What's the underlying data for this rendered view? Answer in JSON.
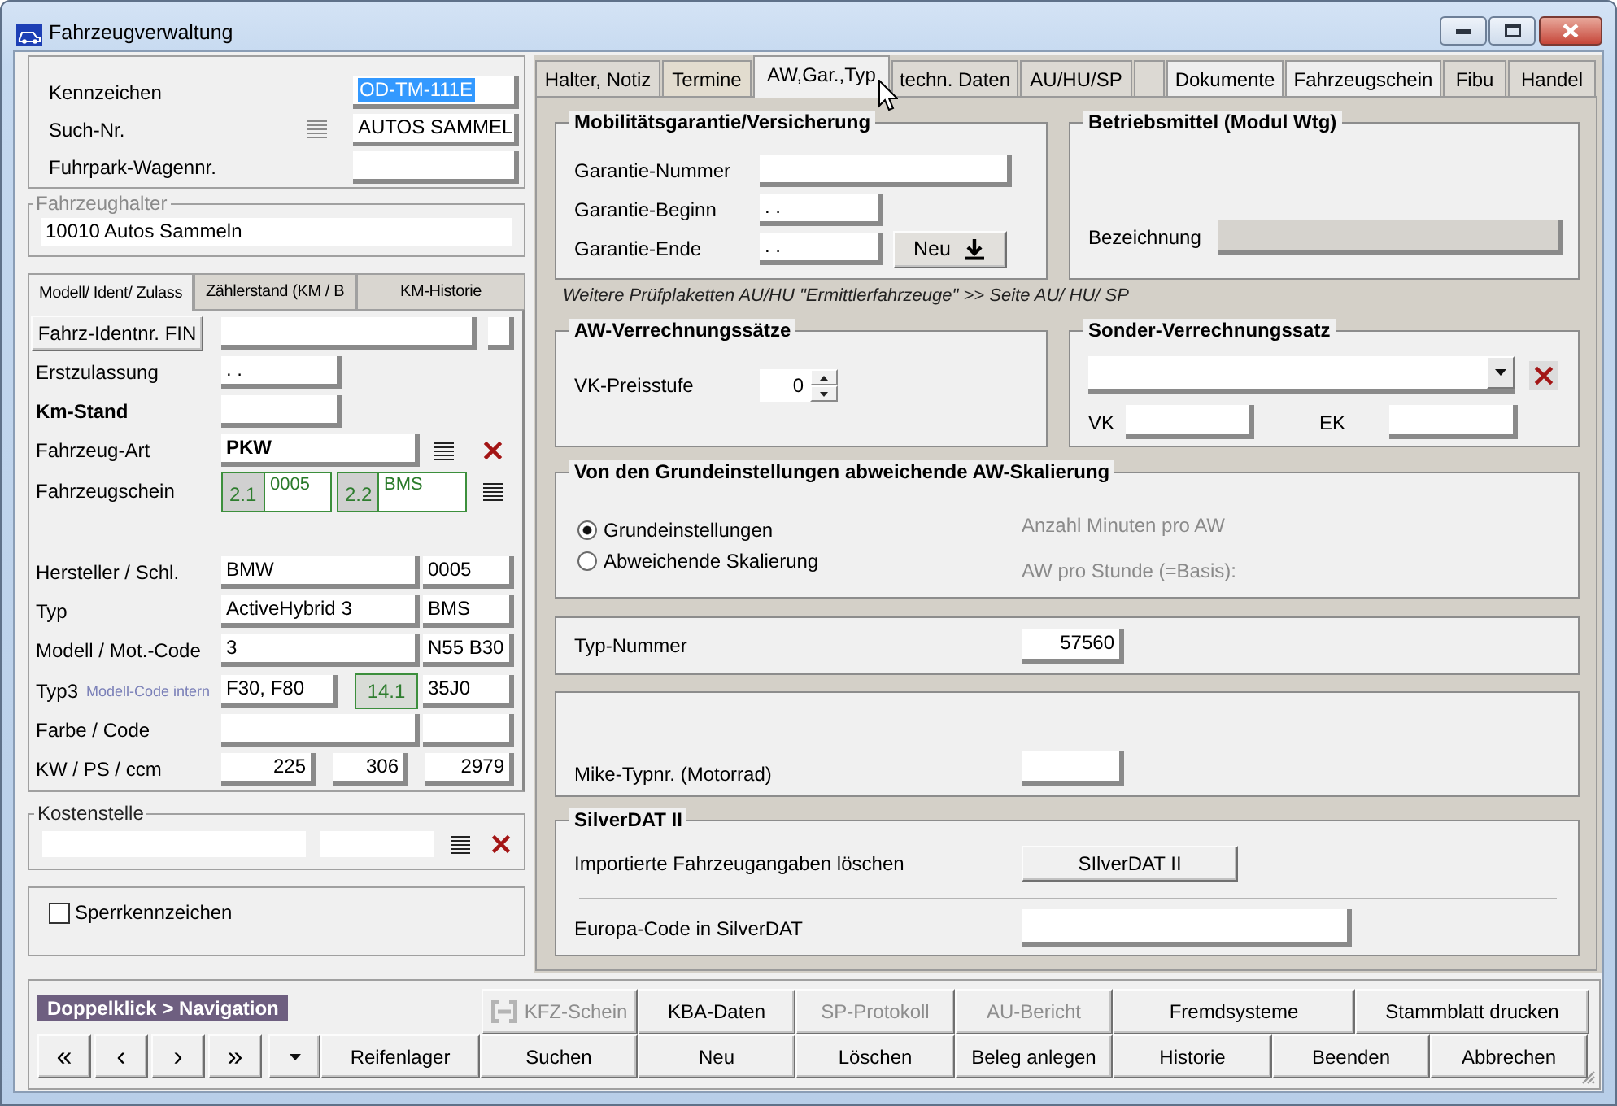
{
  "window": {
    "title": "Fahrzeugverwaltung"
  },
  "identity": {
    "rows": [
      {
        "label": "Kennzeichen",
        "value": "OD-TM-111E",
        "highlighted": true,
        "list_icon": false
      },
      {
        "label": "Such-Nr.",
        "value": "AUTOS SAMMEL",
        "highlighted": false,
        "list_icon": true
      },
      {
        "label": "Fuhrpark-Wagennr.",
        "highlighted": false,
        "list_icon": false
      }
    ]
  },
  "owner": {
    "legend": "Fahrzeughalter",
    "value": "10010 Autos Sammeln"
  },
  "left_tabs": [
    {
      "label": "Modell/ Ident/ Zulass",
      "selected": true
    },
    {
      "label": "Zählerstand (KM / B",
      "selected": false
    },
    {
      "label": "KM-Historie",
      "selected": false
    }
  ],
  "vehicle": {
    "rows": [
      {
        "kind": "fin",
        "button": "Fahrz-Identnr. FIN"
      },
      {
        "kind": "single",
        "label": "Erstzulassung",
        "value": ". .",
        "bold": false
      },
      {
        "kind": "single",
        "label": "Km-Stand",
        "bold": true
      },
      {
        "kind": "lookup",
        "label": "Fahrzeug-Art",
        "value": "PKW"
      },
      {
        "kind": "registration",
        "label": "Fahrzeugschein",
        "codes": [
          {
            "code": "2.1",
            "value": "0005"
          },
          {
            "code": "2.2",
            "value": "BMS"
          }
        ]
      },
      {
        "kind": "pair",
        "label": "Hersteller / Schl.",
        "value": "BMW",
        "key": "0005"
      },
      {
        "kind": "pair",
        "label": "Typ",
        "value": "ActiveHybrid 3",
        "key": "BMS"
      },
      {
        "kind": "pair",
        "label": "Modell / Mot.-Code",
        "value": "3",
        "key": "N55 B30"
      },
      {
        "kind": "typ3",
        "label": "Typ3",
        "hint": "Modell-Code intern",
        "value": "F30, F80",
        "badge": "14.1",
        "key": "35J0"
      },
      {
        "kind": "pair",
        "label": "Farbe / Code"
      },
      {
        "kind": "triple",
        "label": "KW / PS / ccm",
        "values": [
          "225",
          "306",
          "2979"
        ]
      }
    ]
  },
  "cost_center": {
    "legend": "Kostenstelle"
  },
  "lock": {
    "label": "Sperrkennzeichen",
    "checked": false
  },
  "tabs": [
    {
      "label": "Halter, Notiz",
      "selected": false
    },
    {
      "label": "Termine",
      "selected": false
    },
    {
      "label": "AW,Gar.,Typ",
      "selected": true
    },
    {
      "label": "techn. Daten",
      "selected": false
    },
    {
      "label": "AU/HU/SP",
      "selected": false
    },
    {
      "selected": false
    },
    {
      "label": "Dokumente",
      "selected": false
    },
    {
      "label": "Fahrzeugschein",
      "selected": false
    },
    {
      "label": "Fibu",
      "selected": false
    },
    {
      "label": "Handel",
      "selected": false
    }
  ],
  "guarantee": {
    "legend": "Mobilitätsgarantie/Versicherung",
    "rows": [
      {
        "kind": "text",
        "label": "Garantie-Nummer"
      },
      {
        "kind": "date",
        "label": "Garantie-Beginn",
        "value": ". ."
      },
      {
        "kind": "date",
        "label": "Garantie-Ende",
        "value": ". ."
      }
    ],
    "button": "Neu"
  },
  "resources": {
    "legend": "Betriebsmittel (Modul Wtg)",
    "label": "Bezeichnung",
    "disabled": true
  },
  "note": "Weitere Prüfplaketten AU/HU \"Ermittlerfahrzeuge\" >> Seite AU/ HU/ SP",
  "rates": {
    "legend": "AW-Verrechnungssätze",
    "label": "VK-Preisstufe",
    "value": "0"
  },
  "special_rate": {
    "legend": "Sonder-Verrechnungssatz",
    "vk_label": "VK",
    "ek_label": "EK"
  },
  "scaling": {
    "legend": "Von den Grundeinstellungen abweichende AW-Skalierung",
    "options": [
      {
        "label": "Grundeinstellungen",
        "selected": true
      },
      {
        "label": "Abweichende Skalierung",
        "selected": false
      }
    ],
    "info": [
      {
        "label": "Anzahl Minuten pro AW",
        "disabled": true
      },
      {
        "label": "AW pro Stunde (=Basis):",
        "disabled": true
      }
    ]
  },
  "type_number": {
    "label": "Typ-Nummer",
    "value": "57560"
  },
  "motorcycle": {
    "label": "Mike-Typnr. (Motorrad)"
  },
  "silverdat": {
    "legend": "SilverDAT II",
    "import_label": "Importierte Fahrzeugangaben löschen",
    "button": "SIlverDAT II",
    "code_label": "Europa-Code in SilverDAT"
  },
  "bottom_bar": {
    "hint": "Doppelklick > Navigation",
    "nav_buttons": [
      "«",
      "‹",
      "›",
      "»"
    ],
    "top_buttons": [
      {
        "label": "KFZ-Schein",
        "kind": "icon",
        "disabled": true
      },
      {
        "label": "KBA-Daten",
        "kind": "text",
        "disabled": false
      },
      {
        "label": "SP-Protokoll",
        "kind": "text",
        "disabled": true
      },
      {
        "label": "AU-Bericht",
        "kind": "text",
        "disabled": true
      },
      {
        "label": "Fremdsysteme",
        "kind": "text",
        "disabled": false
      },
      {
        "label": "Stammblatt drucken",
        "kind": "text",
        "disabled": false
      }
    ],
    "bottom_buttons": [
      {
        "label": "Reifenlager",
        "disabled": false
      },
      {
        "label": "Suchen",
        "disabled": false
      },
      {
        "label": "Neu",
        "disabled": false
      },
      {
        "label": "Löschen",
        "disabled": false
      },
      {
        "label": "Beleg anlegen",
        "disabled": false
      },
      {
        "label": "Historie",
        "disabled": false
      },
      {
        "label": "Beenden",
        "disabled": false
      },
      {
        "label": "Abbrechen",
        "disabled": false
      }
    ]
  }
}
